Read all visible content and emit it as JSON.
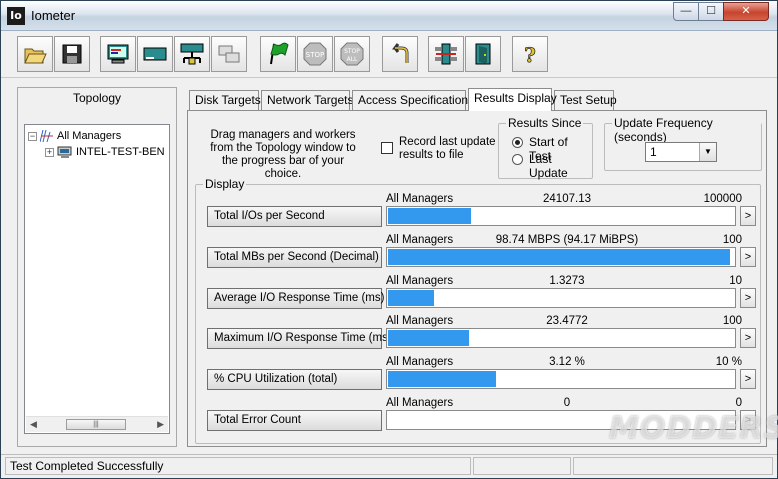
{
  "window": {
    "icon_text": "Io",
    "title": "Iometer",
    "minimize_glyph": "—",
    "maximize_glyph": "☐",
    "close_glyph": "✕"
  },
  "toolbar": {
    "buttons": [
      {
        "icon": "open-folder-icon"
      },
      {
        "icon": "save-icon"
      },
      {
        "icon": "display-icon"
      },
      {
        "icon": "disk-worker-icon"
      },
      {
        "icon": "network-worker-icon"
      },
      {
        "icon": "duplicate-worker-icon"
      },
      {
        "icon": "start-flag-icon"
      },
      {
        "icon": "stop-icon",
        "label": "STOP"
      },
      {
        "icon": "stop-all-icon",
        "label": "STOP\nALL"
      },
      {
        "icon": "reset-arrow-icon"
      },
      {
        "icon": "exit-managers-icon"
      },
      {
        "icon": "exit-door-icon"
      },
      {
        "icon": "help-icon",
        "label": "?"
      }
    ]
  },
  "topology": {
    "title": "Topology",
    "root_toggle": "−",
    "root": "All Managers",
    "child_toggle": "+",
    "child": "INTEL-TEST-BEN"
  },
  "tabs": [
    {
      "label": "Disk Targets",
      "active": false
    },
    {
      "label": "Network Targets",
      "active": false
    },
    {
      "label": "Access Specifications",
      "active": false
    },
    {
      "label": "Results Display",
      "active": true
    },
    {
      "label": "Test Setup",
      "active": false
    }
  ],
  "results": {
    "drag_hint": "Drag managers and workers from the Topology window to the progress bar of your choice.",
    "record_label": "Record last update results to file",
    "results_since": {
      "title": "Results Since",
      "options": [
        {
          "label": "Start of Test",
          "selected": true
        },
        {
          "label": "Last Update",
          "selected": false
        }
      ]
    },
    "update_frequency": {
      "title": "Update Frequency (seconds)",
      "value": "1"
    },
    "display_title": "Display",
    "metrics": [
      {
        "label": "Total I/Os per Second",
        "manager": "All Managers",
        "value": "24107.13",
        "max": "100000",
        "fill_fraction": 0.241
      },
      {
        "label": "Total MBs per Second (Decimal)",
        "manager": "All Managers",
        "value": "98.74 MBPS (94.17 MiBPS)",
        "max": "100",
        "fill_fraction": 0.987
      },
      {
        "label": "Average I/O Response Time (ms)",
        "manager": "All Managers",
        "value": "1.3273",
        "max": "10",
        "fill_fraction": 0.133
      },
      {
        "label": "Maximum I/O Response Time (ms)",
        "manager": "All Managers",
        "value": "23.4772",
        "max": "100",
        "fill_fraction": 0.235
      },
      {
        "label": "% CPU Utilization (total)",
        "manager": "All Managers",
        "value": "3.12 %",
        "max": "10 %",
        "fill_fraction": 0.312
      },
      {
        "label": "Total Error Count",
        "manager": "All Managers",
        "value": "0",
        "max": "0",
        "fill_fraction": 0
      }
    ],
    "go_glyph": ">"
  },
  "status": {
    "message": "Test Completed Successfully"
  },
  "watermark": "MODDERS",
  "colors": {
    "bar_fill": "#3399ee"
  }
}
